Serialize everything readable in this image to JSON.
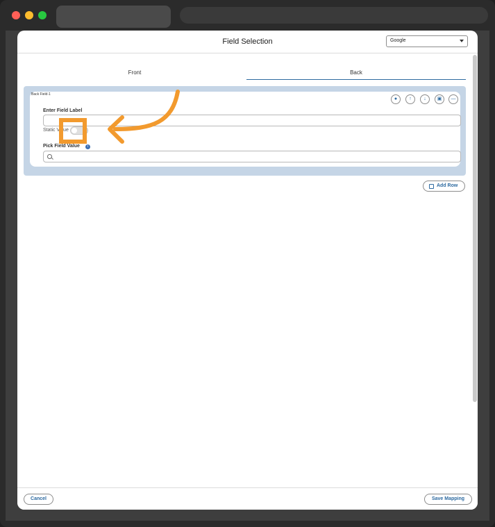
{
  "window": {
    "controls": [
      "close",
      "minimize",
      "maximize"
    ]
  },
  "modal": {
    "title": "Field Selection",
    "selector_value": "Google",
    "tabs": [
      {
        "label": "Front",
        "active": false
      },
      {
        "label": "Back",
        "active": true
      }
    ],
    "field_card": {
      "id_label": "Back Field-1",
      "field_label_heading": "Enter Field Label",
      "field_label_value": "",
      "static_value_label": "Static Value",
      "static_value_toggle_on": false,
      "pick_field_value_label": "Pick Field Value",
      "search_value": "",
      "actions": [
        {
          "name": "bell",
          "icon": "bell-icon",
          "glyph": "🔔"
        },
        {
          "name": "move-up",
          "icon": "arrow-up-icon",
          "glyph": "↑"
        },
        {
          "name": "move-down",
          "icon": "arrow-down-icon",
          "glyph": "↓"
        },
        {
          "name": "delete",
          "icon": "trash-icon",
          "glyph": "🗑"
        },
        {
          "name": "collapse",
          "icon": "minus-icon",
          "glyph": "—"
        }
      ]
    },
    "add_row_label": "Add Row",
    "footer": {
      "cancel_label": "Cancel",
      "save_label": "Save Mapping"
    }
  },
  "colors": {
    "accent": "#2d6aa0",
    "panel_bg": "#c5d5e6",
    "highlight": "#f29a2e"
  }
}
